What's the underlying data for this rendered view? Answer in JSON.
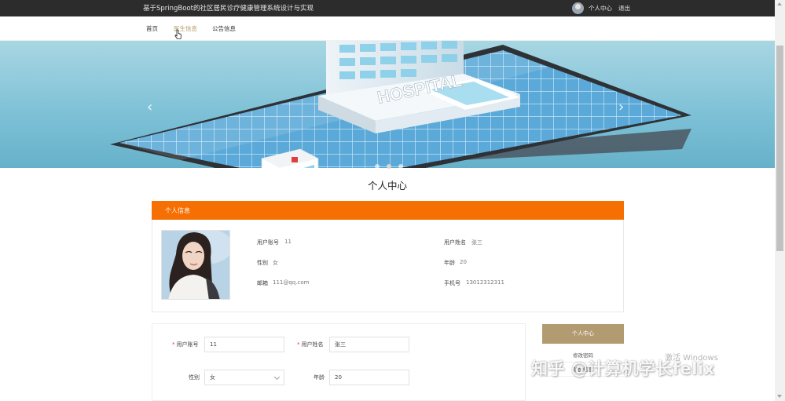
{
  "header": {
    "site_title": "基于SpringBoot的社区居民诊疗健康管理系统设计与实现",
    "user_center": "个人中心",
    "logout": "退出"
  },
  "nav": {
    "items": [
      {
        "label": "首页"
      },
      {
        "label": "医生信息"
      },
      {
        "label": "公告信息"
      }
    ],
    "active_index": 1
  },
  "banner": {
    "sign_text": "HOSPITAL",
    "slide_count": 3,
    "active_slide": 1,
    "prev_symbol": "‹",
    "next_symbol": "›"
  },
  "page": {
    "title": "个人中心"
  },
  "profile_card": {
    "header": "个人信息",
    "fields": {
      "account_label": "用户账号",
      "account_value": "11",
      "name_label": "用户姓名",
      "name_value": "张三",
      "gender_label": "性别",
      "gender_value": "女",
      "age_label": "年龄",
      "age_value": "20",
      "email_label": "邮箱",
      "email_value": "111@qq.com",
      "phone_label": "手机号",
      "phone_value": "13012312311"
    }
  },
  "form": {
    "required_mark": "*",
    "account_label": "用户账号",
    "account_value": "11",
    "name_label": "用户姓名",
    "name_value": "张三",
    "gender_label": "性别",
    "gender_value": "女",
    "age_label": "年龄",
    "age_value": "20"
  },
  "side_menu": {
    "items": [
      {
        "label": "个人中心"
      },
      {
        "label": "修改密码"
      },
      {
        "label": "就医信息"
      }
    ]
  },
  "overlay": {
    "activate_windows": "激活 Windows",
    "watermark": "知乎 @计算机学长felix"
  },
  "colors": {
    "accent_orange": "#f56f02",
    "accent_gold": "#b39b71",
    "topbar_bg": "#2c2c2c"
  }
}
